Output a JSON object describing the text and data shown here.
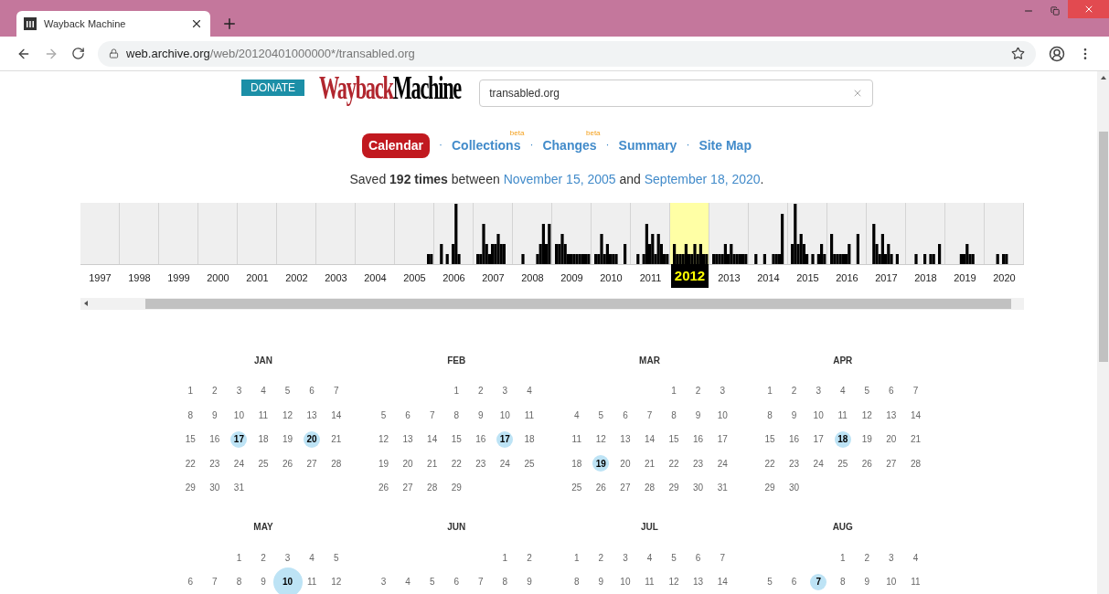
{
  "browser": {
    "tab_title": "Wayback Machine",
    "url_host": "web.archive.org",
    "url_path": "/web/20120401000000*/transabled.org"
  },
  "header": {
    "donate": "DONATE",
    "logo_part_1": "Wayback",
    "logo_part_2": "Machine",
    "search_value": "transabled.org"
  },
  "nav": [
    {
      "label": "Calendar",
      "selected": true
    },
    {
      "sep": "·",
      "label": "Collections",
      "selected": false,
      "badge": "beta"
    },
    {
      "sep": "·",
      "label": "Changes",
      "selected": false,
      "badge": "beta"
    },
    {
      "sep": "·",
      "label": "Summary",
      "selected": false
    },
    {
      "sep": "·",
      "label": "Site Map",
      "selected": false
    }
  ],
  "summary": {
    "prefix": "Saved",
    "count": "192 times",
    "middle": "between",
    "first": "November 15, 2005",
    "and": "and",
    "last": "September 18, 2020",
    "end": "."
  },
  "years": [
    {
      "label": "1997",
      "selected": false
    },
    {
      "label": "1998",
      "selected": false
    },
    {
      "label": "1999",
      "selected": false
    },
    {
      "label": "2000",
      "selected": false
    },
    {
      "label": "2001",
      "selected": false
    },
    {
      "label": "2002",
      "selected": false
    },
    {
      "label": "2003",
      "selected": false
    },
    {
      "label": "2004",
      "selected": false
    },
    {
      "label": "2005",
      "selected": false
    },
    {
      "label": "2006",
      "selected": false
    },
    {
      "label": "2007",
      "selected": false
    },
    {
      "label": "2008",
      "selected": false
    },
    {
      "label": "2009",
      "selected": false
    },
    {
      "label": "2010",
      "selected": false
    },
    {
      "label": "2011",
      "selected": false
    },
    {
      "label": "2012",
      "selected": true
    },
    {
      "label": "2013",
      "selected": false
    },
    {
      "label": "2014",
      "selected": false
    },
    {
      "label": "2015",
      "selected": false
    },
    {
      "label": "2016",
      "selected": false
    },
    {
      "label": "2017",
      "selected": false
    },
    {
      "label": "2018",
      "selected": false
    },
    {
      "label": "2019",
      "selected": false
    },
    {
      "label": "2020",
      "selected": false
    }
  ],
  "months": [
    {
      "name": "JAN",
      "days": [
        {
          "d": "1",
          "captured": false
        },
        {
          "d": "2",
          "captured": false
        },
        {
          "d": "3",
          "captured": false
        },
        {
          "d": "4",
          "captured": false
        },
        {
          "d": "5",
          "captured": false
        },
        {
          "d": "6",
          "captured": false
        },
        {
          "d": "7",
          "captured": false
        },
        {
          "d": "8",
          "captured": false
        },
        {
          "d": "9",
          "captured": false
        },
        {
          "d": "10",
          "captured": false
        },
        {
          "d": "11",
          "captured": false
        },
        {
          "d": "12",
          "captured": false
        },
        {
          "d": "13",
          "captured": false
        },
        {
          "d": "14",
          "captured": false
        },
        {
          "d": "15",
          "captured": false
        },
        {
          "d": "16",
          "captured": false
        },
        {
          "d": "17",
          "captured": true
        },
        {
          "d": "18",
          "captured": false
        },
        {
          "d": "19",
          "captured": false
        },
        {
          "d": "20",
          "captured": true
        },
        {
          "d": "21",
          "captured": false
        },
        {
          "d": "22",
          "captured": false
        },
        {
          "d": "23",
          "captured": false
        },
        {
          "d": "24",
          "captured": false
        },
        {
          "d": "25",
          "captured": false
        },
        {
          "d": "26",
          "captured": false
        },
        {
          "d": "27",
          "captured": false
        },
        {
          "d": "28",
          "captured": false
        },
        {
          "d": "29",
          "captured": false
        },
        {
          "d": "30",
          "captured": false
        },
        {
          "d": "31",
          "captured": false
        }
      ]
    },
    {
      "name": "FEB",
      "days": [
        {
          "d": "1",
          "captured": false
        },
        {
          "d": "2",
          "captured": false
        },
        {
          "d": "3",
          "captured": false
        },
        {
          "d": "4",
          "captured": false
        },
        {
          "d": "5",
          "captured": false
        },
        {
          "d": "6",
          "captured": false
        },
        {
          "d": "7",
          "captured": false
        },
        {
          "d": "8",
          "captured": false
        },
        {
          "d": "9",
          "captured": false
        },
        {
          "d": "10",
          "captured": false
        },
        {
          "d": "11",
          "captured": false
        },
        {
          "d": "12",
          "captured": false
        },
        {
          "d": "13",
          "captured": false
        },
        {
          "d": "14",
          "captured": false
        },
        {
          "d": "15",
          "captured": false
        },
        {
          "d": "16",
          "captured": false
        },
        {
          "d": "17",
          "captured": true
        },
        {
          "d": "18",
          "captured": false
        },
        {
          "d": "19",
          "captured": false
        },
        {
          "d": "20",
          "captured": false
        },
        {
          "d": "21",
          "captured": false
        },
        {
          "d": "22",
          "captured": false
        },
        {
          "d": "23",
          "captured": false
        },
        {
          "d": "24",
          "captured": false
        },
        {
          "d": "25",
          "captured": false
        },
        {
          "d": "26",
          "captured": false
        },
        {
          "d": "27",
          "captured": false
        },
        {
          "d": "28",
          "captured": false
        },
        {
          "d": "29",
          "captured": false
        }
      ]
    },
    {
      "name": "MAR",
      "days": [
        {
          "d": "1",
          "captured": false
        },
        {
          "d": "2",
          "captured": false
        },
        {
          "d": "3",
          "captured": false
        },
        {
          "d": "4",
          "captured": false
        },
        {
          "d": "5",
          "captured": false
        },
        {
          "d": "6",
          "captured": false
        },
        {
          "d": "7",
          "captured": false
        },
        {
          "d": "8",
          "captured": false
        },
        {
          "d": "9",
          "captured": false
        },
        {
          "d": "10",
          "captured": false
        },
        {
          "d": "11",
          "captured": false
        },
        {
          "d": "12",
          "captured": false
        },
        {
          "d": "13",
          "captured": false
        },
        {
          "d": "14",
          "captured": false
        },
        {
          "d": "15",
          "captured": false
        },
        {
          "d": "16",
          "captured": false
        },
        {
          "d": "17",
          "captured": false
        },
        {
          "d": "18",
          "captured": false
        },
        {
          "d": "19",
          "captured": true
        },
        {
          "d": "20",
          "captured": false
        },
        {
          "d": "21",
          "captured": false
        },
        {
          "d": "22",
          "captured": false
        },
        {
          "d": "23",
          "captured": false
        },
        {
          "d": "24",
          "captured": false
        },
        {
          "d": "25",
          "captured": false
        },
        {
          "d": "26",
          "captured": false
        },
        {
          "d": "27",
          "captured": false
        },
        {
          "d": "28",
          "captured": false
        },
        {
          "d": "29",
          "captured": false
        },
        {
          "d": "30",
          "captured": false
        },
        {
          "d": "31",
          "captured": false
        }
      ]
    },
    {
      "name": "APR",
      "days": [
        {
          "d": "1",
          "captured": false
        },
        {
          "d": "2",
          "captured": false
        },
        {
          "d": "3",
          "captured": false
        },
        {
          "d": "4",
          "captured": false
        },
        {
          "d": "5",
          "captured": false
        },
        {
          "d": "6",
          "captured": false
        },
        {
          "d": "7",
          "captured": false
        },
        {
          "d": "8",
          "captured": false
        },
        {
          "d": "9",
          "captured": false
        },
        {
          "d": "10",
          "captured": false
        },
        {
          "d": "11",
          "captured": false
        },
        {
          "d": "12",
          "captured": false
        },
        {
          "d": "13",
          "captured": false
        },
        {
          "d": "14",
          "captured": false
        },
        {
          "d": "15",
          "captured": false
        },
        {
          "d": "16",
          "captured": false
        },
        {
          "d": "17",
          "captured": false
        },
        {
          "d": "18",
          "captured": true
        },
        {
          "d": "19",
          "captured": false
        },
        {
          "d": "20",
          "captured": false
        },
        {
          "d": "21",
          "captured": false
        },
        {
          "d": "22",
          "captured": false
        },
        {
          "d": "23",
          "captured": false
        },
        {
          "d": "24",
          "captured": false
        },
        {
          "d": "25",
          "captured": false
        },
        {
          "d": "26",
          "captured": false
        },
        {
          "d": "27",
          "captured": false
        },
        {
          "d": "28",
          "captured": false
        },
        {
          "d": "29",
          "captured": false
        },
        {
          "d": "30",
          "captured": false
        }
      ]
    },
    {
      "name": "MAY",
      "days": [
        {
          "d": "1",
          "captured": false
        },
        {
          "d": "2",
          "captured": false
        },
        {
          "d": "3",
          "captured": false
        },
        {
          "d": "4",
          "captured": false
        },
        {
          "d": "5",
          "captured": false
        },
        {
          "d": "6",
          "captured": false
        },
        {
          "d": "7",
          "captured": false
        },
        {
          "d": "8",
          "captured": false
        },
        {
          "d": "9",
          "captured": false
        },
        {
          "d": "10",
          "captured": true,
          "many": true
        },
        {
          "d": "11",
          "captured": false
        },
        {
          "d": "12",
          "captured": false
        }
      ]
    },
    {
      "name": "JUN",
      "days": [
        {
          "d": "1",
          "captured": false
        },
        {
          "d": "2",
          "captured": false
        },
        {
          "d": "3",
          "captured": false
        },
        {
          "d": "4",
          "captured": false
        },
        {
          "d": "5",
          "captured": false
        },
        {
          "d": "6",
          "captured": false
        },
        {
          "d": "7",
          "captured": false
        },
        {
          "d": "8",
          "captured": false
        },
        {
          "d": "9",
          "captured": false
        }
      ]
    },
    {
      "name": "JUL",
      "days": [
        {
          "d": "1",
          "captured": false
        },
        {
          "d": "2",
          "captured": false
        },
        {
          "d": "3",
          "captured": false
        },
        {
          "d": "4",
          "captured": false
        },
        {
          "d": "5",
          "captured": false
        },
        {
          "d": "6",
          "captured": false
        },
        {
          "d": "7",
          "captured": false
        },
        {
          "d": "8",
          "captured": false
        },
        {
          "d": "9",
          "captured": false
        },
        {
          "d": "10",
          "captured": false
        },
        {
          "d": "11",
          "captured": false
        },
        {
          "d": "12",
          "captured": false
        },
        {
          "d": "13",
          "captured": false
        },
        {
          "d": "14",
          "captured": false
        }
      ]
    },
    {
      "name": "AUG",
      "days": [
        {
          "d": "1",
          "captured": false
        },
        {
          "d": "2",
          "captured": false
        },
        {
          "d": "3",
          "captured": false
        },
        {
          "d": "4",
          "captured": false
        },
        {
          "d": "5",
          "captured": false
        },
        {
          "d": "6",
          "captured": false
        },
        {
          "d": "7",
          "captured": true
        },
        {
          "d": "8",
          "captured": false
        },
        {
          "d": "9",
          "captured": false
        },
        {
          "d": "10",
          "captured": false
        },
        {
          "d": "11",
          "captured": false
        }
      ]
    }
  ]
}
